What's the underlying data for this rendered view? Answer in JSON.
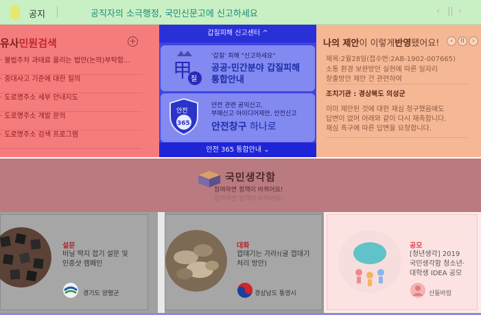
{
  "notice": {
    "label": "공지",
    "text": "공직자의 소극행정, 국민신문고에 신고하세요",
    "prev": "‹",
    "pause": "||",
    "next": "›"
  },
  "complaint_search": {
    "title_prefix": "유사",
    "title_main": "민원검색",
    "add": "+",
    "items": [
      "불법주차 과태료 올리는 법안(논의)부탁합...",
      "중대사고 기준에 대한 질의",
      "도로명주소 세부 안내지도",
      "도로명주소 개발 문의",
      "도로명주소 검색 프로그램"
    ]
  },
  "report_center": {
    "header": "갑질피해 신고센터 ^",
    "card1": {
      "sub": "'갑질' 피해 \"신고하세요\"",
      "main_line1": "공공·민간분야 갑질피해",
      "main_line2": "통합안내",
      "icon_text": "甲",
      "icon_badge": "질"
    },
    "card2": {
      "sub_line1": "안전 관련 공익신고,",
      "sub_line2": "부패신고 아이디어제안, 안전신고",
      "main_bold": "안전창구",
      "main_light": " 하나로",
      "shield_top": "안전",
      "shield_num": "365"
    },
    "footer": "안전 365 통합안내 ⌄"
  },
  "my_proposal": {
    "title_prefix": "나의 제안",
    "title_mid": "이 이렇게",
    "title_bold": "반영",
    "title_suffix": "됐어요!",
    "prev": "‹",
    "pause": "II",
    "next": "›",
    "meta": "제목:2월28일(접수번:2AB-1902-007665)",
    "body_line1": "소통 환경 보완방안 실현에 따른 일자리",
    "body_line2": "창출방안 제안 건 관련하여",
    "org": "조치기관 : 경상북도 의성군",
    "reply_line1": "이미 제안된 것에 대한 재심 청구했음에도",
    "reply_line2": "답변이 없어 아래와 같이 다시 재촉합니다.",
    "reply_line3": "재심 촉구에 따른 답변을 요청합니다."
  },
  "idea": {
    "title": "국민생각함",
    "subtitle": "참여하면 정책이 바뀌어요!",
    "ghost": "참여하면 정책이 바뀌어요!"
  },
  "cards": [
    {
      "category": "설문",
      "desc_line1": "비닐 딱지 접기 설문 및",
      "desc_line2": "인증샷 캠페인",
      "org": "경기도 양평군"
    },
    {
      "category": "대화",
      "desc_line1": "껍데기는 가라!(굴 껍데기",
      "desc_line2": "처리 방안)",
      "org": "경상남도 통영시"
    },
    {
      "category": "공모",
      "desc_line1": "[청년생각] 2019",
      "desc_line2": "국민생각함 청소년·",
      "desc_line3": "대학생 IDEA 공모",
      "org": "산들바람"
    }
  ],
  "colors": {
    "notice_bg": "#c9f0c4",
    "left_bg": "#f57c7d",
    "center_bg": "#3f45e0",
    "right_bg": "#f6b894",
    "idea_bg": "#b97a80"
  }
}
